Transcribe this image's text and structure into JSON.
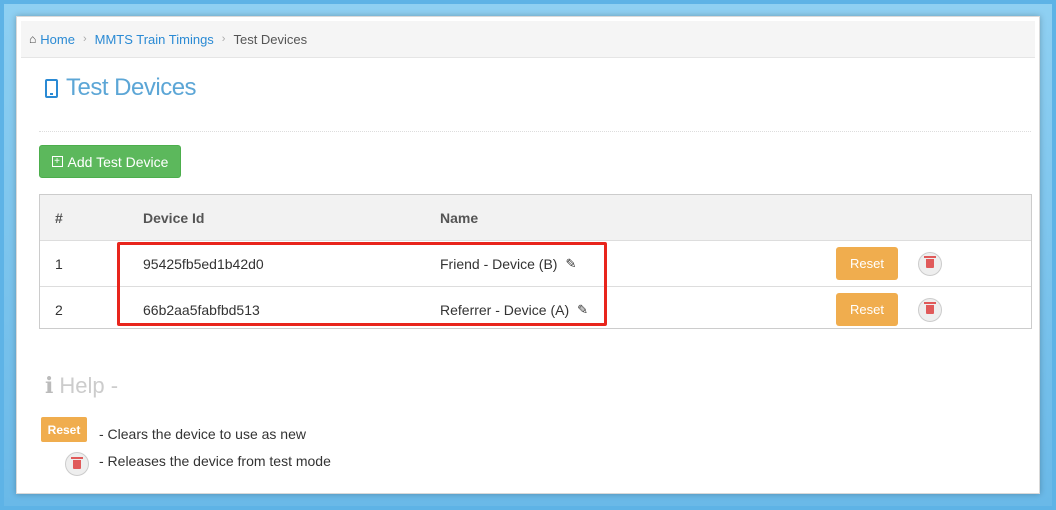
{
  "breadcrumb": {
    "home": "Home",
    "section": "MMTS Train Timings",
    "current": "Test Devices"
  },
  "page": {
    "title": "Test Devices"
  },
  "toolbar": {
    "add_label": "Add Test Device"
  },
  "table": {
    "headers": [
      "#",
      "Device Id",
      "Name"
    ],
    "rows": [
      {
        "num": "1",
        "device_id": "95425fb5ed1b42d0",
        "name": "Friend - Device (B)",
        "reset": "Reset"
      },
      {
        "num": "2",
        "device_id": "66b2aa5fabfbd513",
        "name": "Referrer - Device (A)",
        "reset": "Reset"
      }
    ]
  },
  "help": {
    "title": "Help -",
    "reset_label": "Reset",
    "reset_desc": "- Clears the device to use as new",
    "delete_desc": "- Releases the device from test mode"
  },
  "colors": {
    "accent": "#2a8ad4",
    "success": "#5cb85c",
    "warning": "#f0ad4e",
    "danger": "#e05a5a",
    "highlight": "#e8251c"
  }
}
